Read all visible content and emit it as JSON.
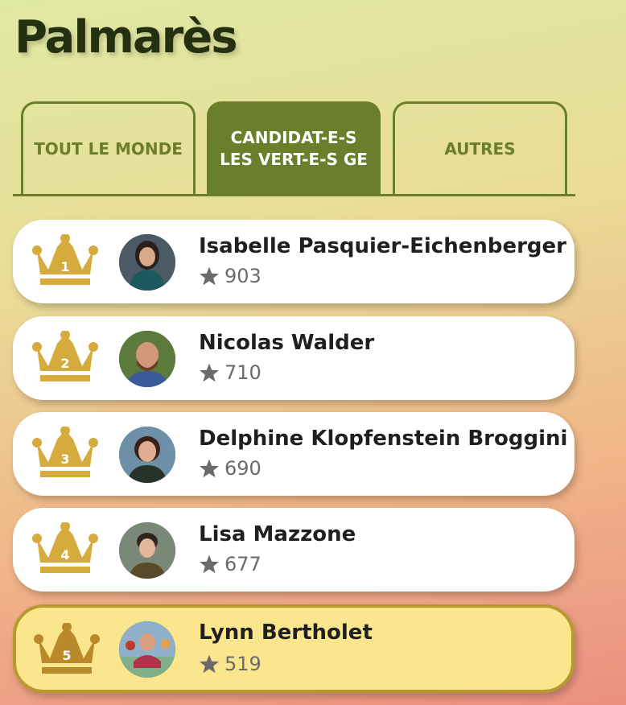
{
  "page": {
    "title": "Palmarès"
  },
  "tabs": [
    {
      "label": "TOUT LE MONDE",
      "active": false
    },
    {
      "label": "CANDIDAT-E-S LES VERT-E-S GE",
      "active": true
    },
    {
      "label": "AUTRES",
      "active": false
    }
  ],
  "ranking": [
    {
      "rank": "1",
      "name": "Isabelle Pasquier-Eichenberger",
      "score": "903",
      "highlighted": false
    },
    {
      "rank": "2",
      "name": "Nicolas Walder",
      "score": "710",
      "highlighted": false
    },
    {
      "rank": "3",
      "name": "Delphine Klopfenstein Broggini",
      "score": "690",
      "highlighted": false
    },
    {
      "rank": "4",
      "name": "Lisa Mazzone",
      "score": "677",
      "highlighted": false
    },
    {
      "rank": "5",
      "name": "Lynn Bertholet",
      "score": "519",
      "highlighted": true
    }
  ],
  "colors": {
    "accent_green": "#6b7e2b",
    "crown_gold": "#d5ab3d",
    "highlight_bg": "#fbe68d",
    "highlight_border": "#b79a2f",
    "score_gray": "#6a6a6a"
  },
  "icons": {
    "crown": "crown-icon",
    "star": "star-icon"
  }
}
